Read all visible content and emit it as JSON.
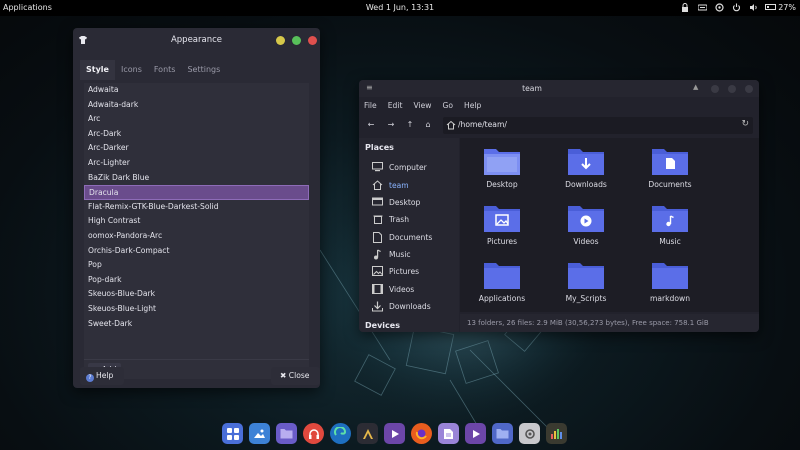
{
  "topbar": {
    "applications": "Applications",
    "clock": "Wed  1 Jun, 13:31",
    "battery": "27%"
  },
  "appearance": {
    "title": "Appearance",
    "tabs": [
      {
        "label": "Style",
        "active": true
      },
      {
        "label": "Icons",
        "active": false
      },
      {
        "label": "Fonts",
        "active": false
      },
      {
        "label": "Settings",
        "active": false
      }
    ],
    "themes": [
      {
        "label": "Adwaita"
      },
      {
        "label": "Adwaita-dark"
      },
      {
        "label": "Arc"
      },
      {
        "label": "Arc-Dark"
      },
      {
        "label": "Arc-Darker"
      },
      {
        "label": "Arc-Lighter"
      },
      {
        "label": "BaZik Dark Blue"
      },
      {
        "label": "Dracula",
        "selected": true
      },
      {
        "label": "Flat-Remix-GTK-Blue-Darkest-Solid"
      },
      {
        "label": "High Contrast"
      },
      {
        "label": "oomox-Pandora-Arc"
      },
      {
        "label": "Orchis-Dark-Compact"
      },
      {
        "label": "Pop"
      },
      {
        "label": "Pop-dark"
      },
      {
        "label": "Skeuos-Blue-Dark"
      },
      {
        "label": "Skeuos-Blue-Light"
      },
      {
        "label": "Sweet-Dark"
      }
    ],
    "add_label": "+ Add",
    "help_label": "Help",
    "close_label": "✖ Close",
    "accent": "#6a4c8c"
  },
  "file_manager": {
    "title": "team",
    "menu": [
      "File",
      "Edit",
      "View",
      "Go",
      "Help"
    ],
    "path": "/home/team/",
    "sidebar": {
      "places_heading": "Places",
      "devices_heading": "Devices",
      "items": [
        {
          "label": "Computer",
          "icon": "computer-icon"
        },
        {
          "label": "team",
          "icon": "home-icon"
        },
        {
          "label": "Desktop",
          "icon": "desktop-icon"
        },
        {
          "label": "Trash",
          "icon": "trash-icon"
        },
        {
          "label": "Documents",
          "icon": "documents-icon"
        },
        {
          "label": "Music",
          "icon": "music-icon"
        },
        {
          "label": "Pictures",
          "icon": "pictures-icon"
        },
        {
          "label": "Videos",
          "icon": "videos-icon"
        },
        {
          "label": "Downloads",
          "icon": "downloads-icon"
        }
      ]
    },
    "folders": [
      {
        "label": "Desktop",
        "icon": "desktop-folder-icon"
      },
      {
        "label": "Downloads",
        "icon": "downloads-folder-icon"
      },
      {
        "label": "Documents",
        "icon": "documents-folder-icon"
      },
      {
        "label": "Pictures",
        "icon": "pictures-folder-icon"
      },
      {
        "label": "Videos",
        "icon": "videos-folder-icon"
      },
      {
        "label": "Music",
        "icon": "music-folder-icon"
      },
      {
        "label": "Applications",
        "icon": "folder-icon"
      },
      {
        "label": "My_Scripts",
        "icon": "folder-icon"
      },
      {
        "label": "markdown",
        "icon": "folder-icon"
      }
    ],
    "status": "13 folders, 26 files: 2.9 MiB (30,56,273 bytes), Free space: 758.1 GiB",
    "folder_color": "#5b6ee8"
  },
  "dock": [
    {
      "name": "app-grid-icon",
      "color": "#4a6fd8"
    },
    {
      "name": "image-viewer-icon",
      "color": "#3d82d6"
    },
    {
      "name": "files-icon",
      "color": "#6a5cc8"
    },
    {
      "name": "headphones-icon",
      "color": "#e0493e"
    },
    {
      "name": "edge-browser-icon",
      "color": "#2b8fd8"
    },
    {
      "name": "terminal-icon",
      "color": "#2c2c34"
    },
    {
      "name": "vlc-icon",
      "color": "#e8891a"
    },
    {
      "name": "media-player-icon",
      "color": "#6c46a8"
    },
    {
      "name": "firefox-icon",
      "color": "#e85d1e"
    },
    {
      "name": "text-editor-icon",
      "color": "#9a84d8"
    },
    {
      "name": "video-player-icon",
      "color": "#6c46a8"
    },
    {
      "name": "folder-app-icon",
      "color": "#5068c8"
    },
    {
      "name": "settings-icon",
      "color": "#c8c8cc"
    },
    {
      "name": "paint-icon",
      "color": "#d8c040"
    }
  ]
}
